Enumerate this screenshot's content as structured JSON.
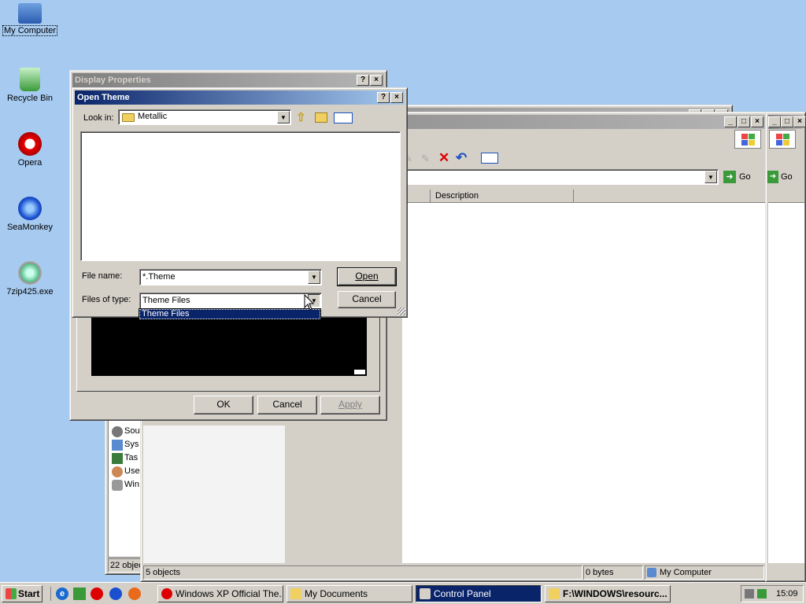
{
  "desktop": {
    "icons": [
      {
        "label": "My Computer",
        "icon": "computer-icon"
      },
      {
        "label": "Recycle Bin",
        "icon": "recycle-bin-icon"
      },
      {
        "label": "Opera",
        "icon": "opera-icon"
      },
      {
        "label": "SeaMonkey",
        "icon": "seamonkey-icon"
      },
      {
        "label": "7zip425.exe",
        "icon": "installer-icon"
      }
    ]
  },
  "explorer_right": {
    "go_label": "Go",
    "columns": [
      "Description"
    ],
    "status": {
      "objects": "5 objects",
      "size": "0 bytes",
      "location": "My Computer"
    }
  },
  "control_panel": {
    "items": [
      "Sou",
      "Sys",
      "Tas",
      "Use",
      "Win"
    ],
    "status": "22 objec"
  },
  "display_properties": {
    "title": "Display Properties",
    "ok": "OK",
    "cancel": "Cancel",
    "apply": "Apply"
  },
  "open_dialog": {
    "title": "Open Theme",
    "look_in_label": "Look in:",
    "look_in_value": "Metallic",
    "file_name_label": "File name:",
    "file_name_value": "*.Theme",
    "files_of_type_label": "Files of type:",
    "files_of_type_value": "Theme Files",
    "dropdown_option": "Theme Files",
    "open_button": "Open",
    "cancel_button": "Cancel"
  },
  "taskbar": {
    "start_label": "Start",
    "tasks": [
      {
        "label": "Windows XP Official The...",
        "active": false
      },
      {
        "label": "My Documents",
        "active": false
      },
      {
        "label": "Control Panel",
        "active": true
      },
      {
        "label": "F:\\WINDOWS\\resourc...",
        "active": false
      }
    ],
    "clock": "15:09"
  },
  "colors": {
    "desktop": "#a6caf0",
    "active_title": "#0a246a",
    "face": "#d4d0c8"
  }
}
